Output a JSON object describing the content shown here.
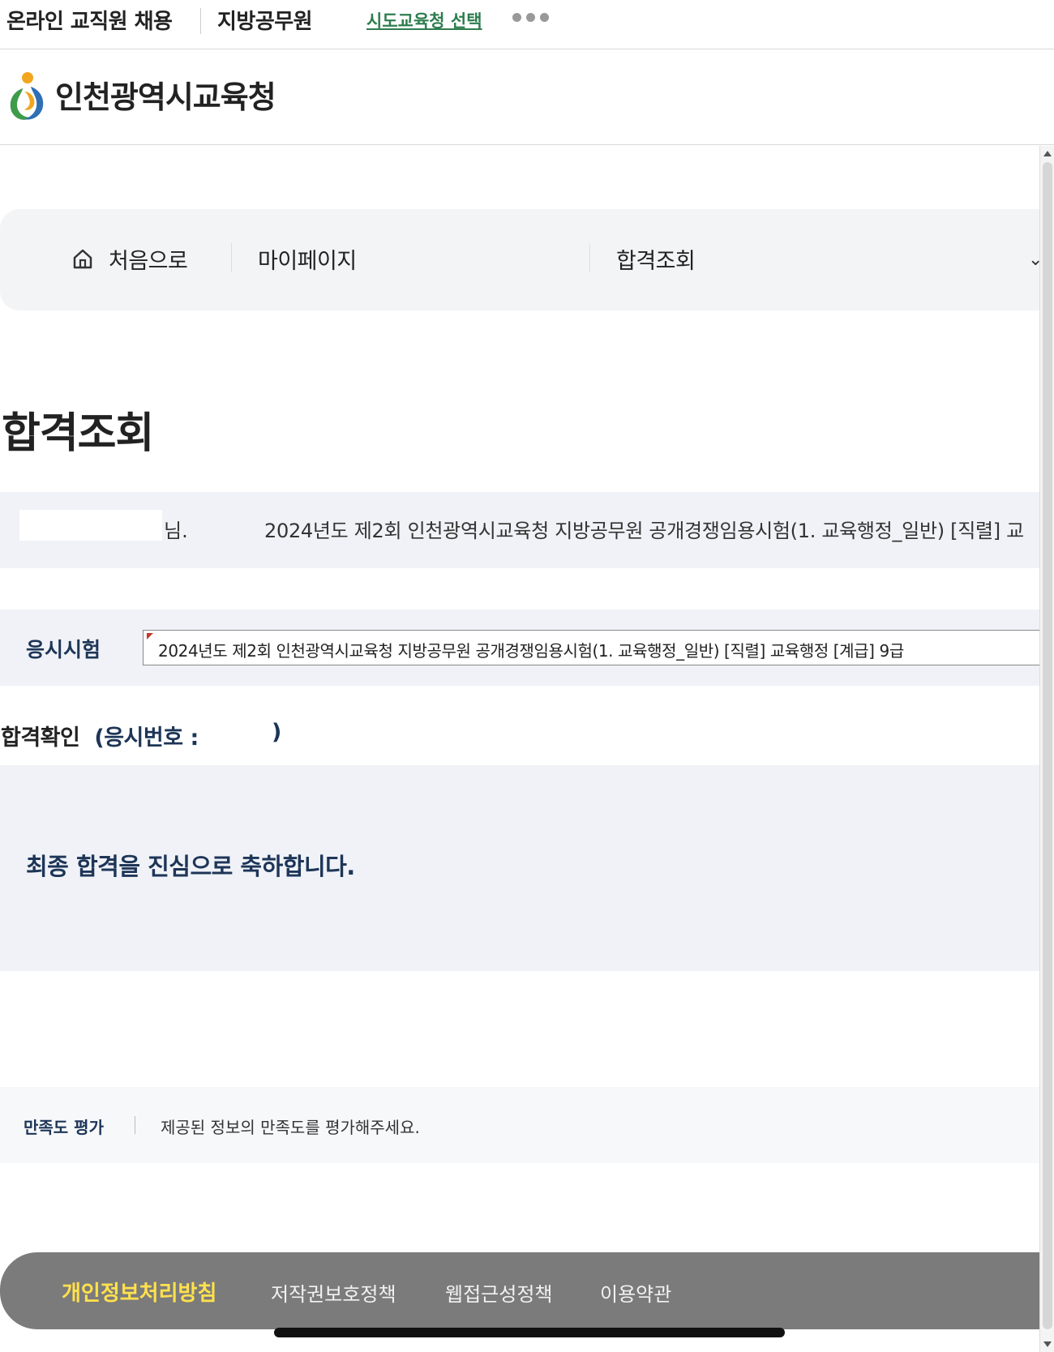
{
  "top_bar": {
    "items": [
      "온라인 교직원 채용",
      "지방공무원"
    ],
    "region_link": "시도교육청 선택"
  },
  "header": {
    "org_name": "인천광역시교육청"
  },
  "breadcrumb": {
    "home": "처음으로",
    "level1": "마이페이지",
    "level2": "합격조회"
  },
  "page": {
    "title": "합격조회"
  },
  "greeting": {
    "suffix": "님.",
    "exam_text": "2024년도 제2회 인천광역시교육청 지방공무원 공개경쟁임용시험(1. 교육행정_일반) [직렬] 교"
  },
  "exam_select": {
    "label": "응시시험",
    "value": "2024년도 제2회 인천광역시교육청 지방공무원 공개경쟁임용시험(1. 교육행정_일반) [직렬] 교육행정 [계급] 9급"
  },
  "confirm": {
    "title": "합격확인",
    "applicant_number_label": "(응시번호 :",
    "close_paren": ")"
  },
  "result": {
    "message": "최종 합격을 진심으로 축하합니다."
  },
  "survey": {
    "label": "만족도 평가",
    "text": "제공된 정보의 만족도를 평가해주세요."
  },
  "footer": {
    "links": [
      "개인정보처리방침",
      "저작권보호정책",
      "웹접근성정책",
      "이용약관"
    ]
  },
  "colors": {
    "link_green": "#2e7d4f",
    "navy": "#1d3557",
    "footer_bg": "#7b7b7b",
    "footer_highlight": "#ffe14d",
    "panel_bg": "#f0f2f7"
  }
}
